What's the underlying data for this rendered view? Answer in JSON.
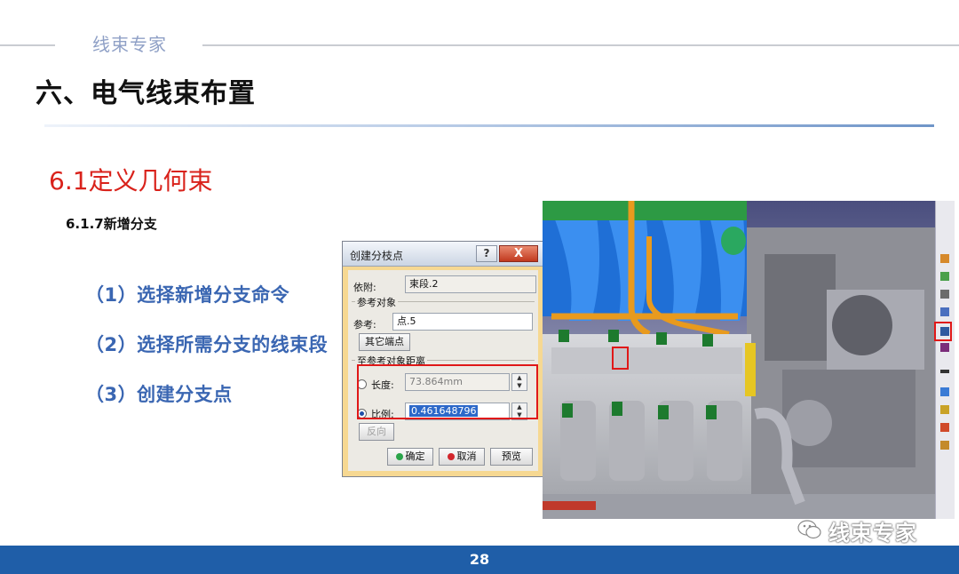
{
  "header": {
    "brand": "线束专家",
    "section_title": "六、电气线束布置"
  },
  "subsection": {
    "title": "6.1定义几何束",
    "subtitle": "6.1.7新增分支"
  },
  "steps": [
    "（1）选择新增分支命令",
    "（2）选择所需分支的线束段",
    "（3）创建分支点"
  ],
  "dialog": {
    "title": "创建分枝点",
    "help_label": "?",
    "close_label": "X",
    "support_label": "依附:",
    "support_value": "束段.2",
    "reference_group": "参考对象",
    "reference_label": "参考:",
    "reference_value": "点.5",
    "other_endpoint_button": "其它端点",
    "distance_group": "至参考对象距离",
    "length_label": "长度:",
    "length_value": "73.864mm",
    "ratio_label": "比例:",
    "ratio_value": "0.461648796",
    "reverse_button": "反向",
    "ok_button": "确定",
    "cancel_button": "取消",
    "preview_button": "预览"
  },
  "footer": {
    "page_number": "28"
  },
  "watermark": {
    "text": "线束专家",
    "icon": "wechat-icon"
  }
}
